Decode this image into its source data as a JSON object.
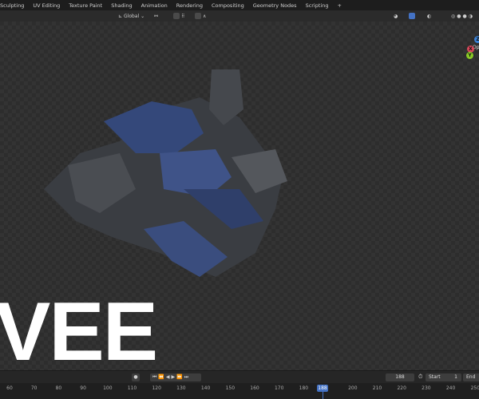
{
  "workspace_tabs": [
    "Sculpting",
    "UV Editing",
    "Texture Paint",
    "Shading",
    "Animation",
    "Rendering",
    "Compositing",
    "Geometry Nodes",
    "Scripting",
    "+"
  ],
  "toolbar": {
    "orientation": "Global"
  },
  "viewport": {
    "overlay_text": "VEE",
    "options_label": "Op",
    "gizmo": {
      "x": "X",
      "y": "Y",
      "z": "Z"
    }
  },
  "timeline": {
    "current_frame": "188",
    "start_label": "Start",
    "start_value": "1",
    "end_label": "End",
    "ticks": [
      "60",
      "70",
      "80",
      "90",
      "100",
      "110",
      "120",
      "130",
      "140",
      "150",
      "160",
      "170",
      "180",
      "200",
      "210",
      "220",
      "230",
      "240",
      "250"
    ]
  },
  "colors": {
    "accent": "#4472c4",
    "x_axis": "#d9475a",
    "y_axis": "#8ac926",
    "z_axis": "#3b82d6"
  }
}
